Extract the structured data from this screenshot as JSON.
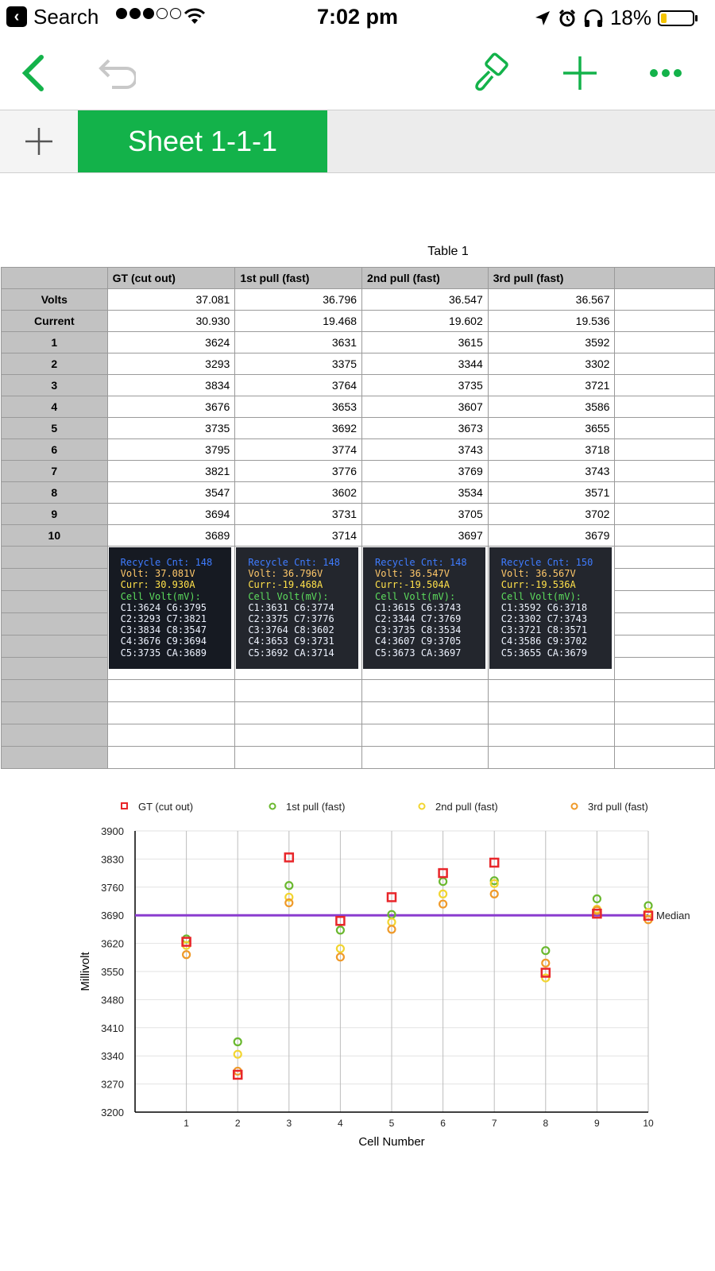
{
  "status_bar": {
    "back_app": "Search",
    "time": "7:02 pm",
    "battery": "18%",
    "battery_level": 0.18
  },
  "tabs": [
    {
      "label": "Sheet 1-1-1",
      "active": true
    }
  ],
  "table": {
    "title": "Table 1",
    "columns": [
      "GT (cut out)",
      "1st pull (fast)",
      "2nd pull (fast)",
      "3rd pull (fast)"
    ],
    "rows": [
      {
        "label": "Volts",
        "values": [
          "37.081",
          "36.796",
          "36.547",
          "36.567"
        ]
      },
      {
        "label": "Current",
        "values": [
          "30.930",
          "19.468",
          "19.602",
          "19.536"
        ]
      },
      {
        "label": "1",
        "values": [
          "3624",
          "3631",
          "3615",
          "3592"
        ]
      },
      {
        "label": "2",
        "values": [
          "3293",
          "3375",
          "3344",
          "3302"
        ]
      },
      {
        "label": "3",
        "values": [
          "3834",
          "3764",
          "3735",
          "3721"
        ]
      },
      {
        "label": "4",
        "values": [
          "3676",
          "3653",
          "3607",
          "3586"
        ]
      },
      {
        "label": "5",
        "values": [
          "3735",
          "3692",
          "3673",
          "3655"
        ]
      },
      {
        "label": "6",
        "values": [
          "3795",
          "3774",
          "3743",
          "3718"
        ]
      },
      {
        "label": "7",
        "values": [
          "3821",
          "3776",
          "3769",
          "3743"
        ]
      },
      {
        "label": "8",
        "values": [
          "3547",
          "3602",
          "3534",
          "3571"
        ]
      },
      {
        "label": "9",
        "values": [
          "3694",
          "3731",
          "3705",
          "3702"
        ]
      },
      {
        "label": "10",
        "values": [
          "3689",
          "3714",
          "3697",
          "3679"
        ]
      }
    ],
    "screenshots": [
      {
        "lines": [
          "Recycle Cnt: 148",
          "Volt: 37.081V",
          "Curr: 30.930A",
          "Cell Volt(mV):",
          "C1:3624 C6:3795",
          "C2:3293 C7:3821",
          "C3:3834 C8:3547",
          "C4:3676 C9:3694",
          "C5:3735 CA:3689"
        ]
      },
      {
        "lines": [
          "Recycle Cnt: 148",
          "Volt: 36.796V",
          "Curr:-19.468A",
          "Cell Volt(mV):",
          "C1:3631 C6:3774",
          "C2:3375 C7:3776",
          "C3:3764 C8:3602",
          "C4:3653 C9:3731",
          "C5:3692 CA:3714"
        ]
      },
      {
        "lines": [
          "Recycle Cnt: 148",
          "Volt: 36.547V",
          "Curr:-19.504A",
          "Cell Volt(mV):",
          "C1:3615 C6:3743",
          "C2:3344 C7:3769",
          "C3:3735 C8:3534",
          "C4:3607 C9:3705",
          "C5:3673 CA:3697"
        ]
      },
      {
        "lines": [
          "Recycle Cnt: 150",
          "Volt: 36.567V",
          "Curr:-19.536A",
          "Cell Volt(mV):",
          "C1:3592 C6:3718",
          "C2:3302 C7:3743",
          "C3:3721 C8:3571",
          "C4:3586 C9:3702",
          "C5:3655 CA:3679"
        ]
      }
    ]
  },
  "chart_data": {
    "type": "scatter",
    "xlabel": "Cell Number",
    "ylabel": "Millivolt",
    "x": [
      1,
      2,
      3,
      4,
      5,
      6,
      7,
      8,
      9,
      10
    ],
    "xlim": [
      0,
      10
    ],
    "ylim": [
      3200,
      3900
    ],
    "yticks": [
      3200,
      3270,
      3340,
      3410,
      3480,
      3550,
      3620,
      3690,
      3760,
      3830,
      3900
    ],
    "legend_position": "top",
    "series": [
      {
        "name": "GT (cut out)",
        "marker": "square",
        "color": "#e8262a",
        "values": [
          3624,
          3293,
          3834,
          3676,
          3735,
          3795,
          3821,
          3547,
          3694,
          3689
        ]
      },
      {
        "name": "1st pull (fast)",
        "marker": "circle",
        "color": "#6ab82f",
        "values": [
          3631,
          3375,
          3764,
          3653,
          3692,
          3774,
          3776,
          3602,
          3731,
          3714
        ]
      },
      {
        "name": "2nd pull (fast)",
        "marker": "circle",
        "color": "#f2d530",
        "values": [
          3615,
          3344,
          3735,
          3607,
          3673,
          3743,
          3769,
          3534,
          3705,
          3697
        ]
      },
      {
        "name": "3rd pull (fast)",
        "marker": "circle",
        "color": "#ef9a2a",
        "values": [
          3592,
          3302,
          3721,
          3586,
          3655,
          3718,
          3743,
          3571,
          3702,
          3679
        ]
      }
    ],
    "reference_line": {
      "label": "Median",
      "value": 3690,
      "color": "#8a3ccf"
    }
  }
}
